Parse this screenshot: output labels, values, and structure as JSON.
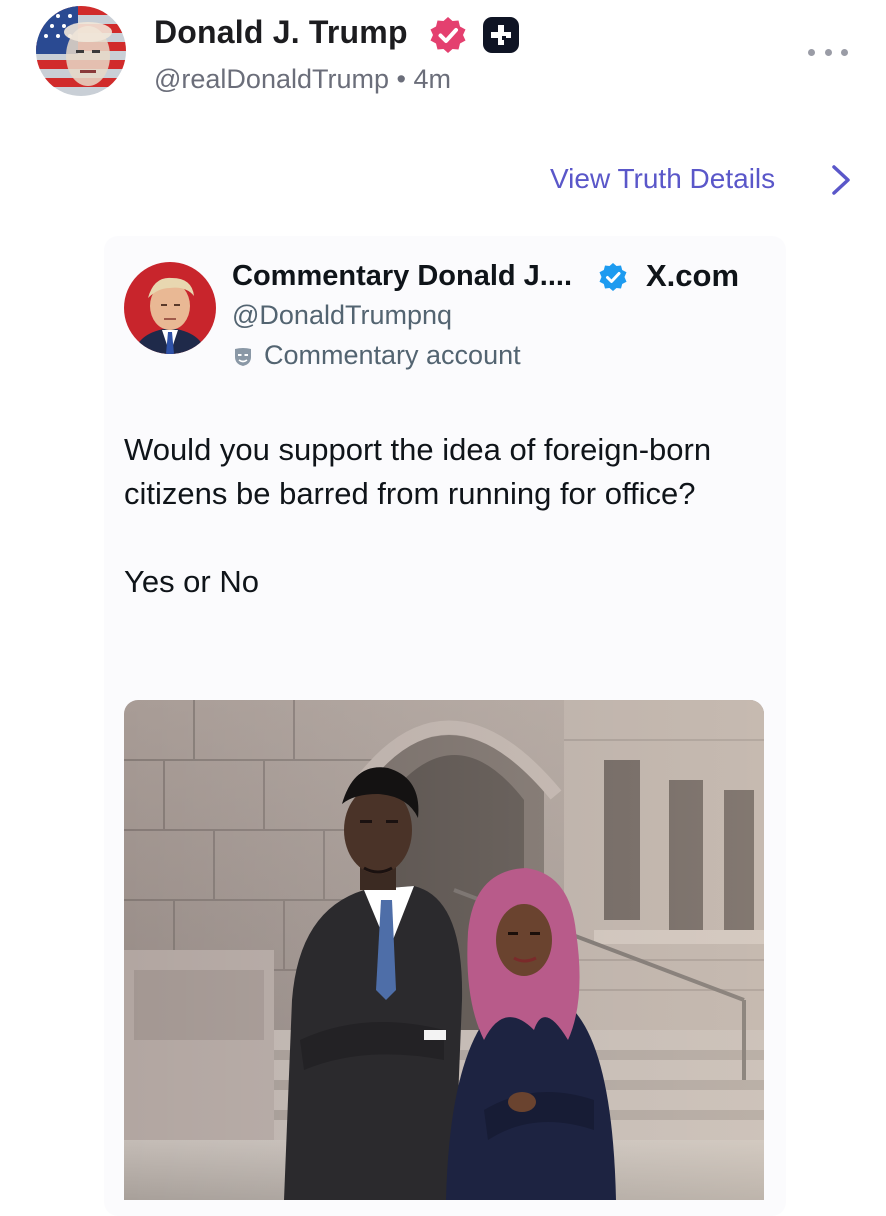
{
  "post": {
    "author_name": "Donald J. Trump",
    "handle": "@realDonaldTrump",
    "separator": "•",
    "time_ago": "4m",
    "view_details_label": "View Truth Details"
  },
  "embed": {
    "name": "Commentary Donald J....",
    "source": "X.com",
    "handle": "@DonaldTrumpnq",
    "account_type": "Commentary account",
    "text_line1": "Would you support the idea of foreign-born citizens be barred from running for office?",
    "text_line2": "Yes or No"
  },
  "icons": {
    "verified": "verified-badge-icon",
    "plus": "plus-badge-icon",
    "more": "more-dots-icon",
    "chevron": "chevron-right-icon",
    "blue_check": "blue-check-icon",
    "mask": "mask-icon"
  },
  "colors": {
    "accent": "#5a57c9",
    "verified_badge": "#e4406f",
    "blue_check": "#1d9bf0",
    "muted_text": "#6b6e7a"
  }
}
